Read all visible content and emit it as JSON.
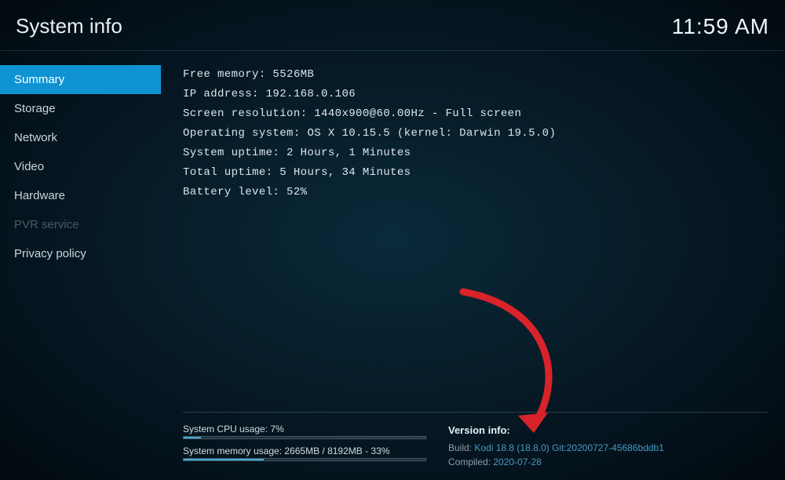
{
  "header": {
    "title": "System info",
    "clock": "11:59 AM"
  },
  "sidebar": {
    "items": [
      {
        "label": "Summary",
        "state": "selected"
      },
      {
        "label": "Storage",
        "state": ""
      },
      {
        "label": "Network",
        "state": ""
      },
      {
        "label": "Video",
        "state": ""
      },
      {
        "label": "Hardware",
        "state": ""
      },
      {
        "label": "PVR service",
        "state": "disabled"
      },
      {
        "label": "Privacy policy",
        "state": ""
      }
    ]
  },
  "summary": {
    "rows": [
      {
        "label": "Free memory: ",
        "value": "5526MB"
      },
      {
        "label": "IP address: ",
        "value": "192.168.0.106"
      },
      {
        "label": "Screen resolution: ",
        "value": "1440x900@60.00Hz - Full screen"
      },
      {
        "label": "Operating system: ",
        "value": "OS X 10.15.5 (kernel: Darwin 19.5.0)"
      },
      {
        "label": "System uptime: ",
        "value": "2 Hours, 1 Minutes"
      },
      {
        "label": "Total uptime: ",
        "value": "5 Hours, 34 Minutes"
      },
      {
        "label": "Battery level: ",
        "value": "52%"
      }
    ]
  },
  "footer": {
    "cpu": {
      "label": "System CPU usage: 7%",
      "pct": 7
    },
    "memory": {
      "label": "System memory usage: 2665MB / 8192MB - 33%",
      "pct": 33
    },
    "version": {
      "title": "Version info:",
      "build_key": "Build: ",
      "build_val": "Kodi 18.8 (18.8.0) Git:20200727-45686bddb1",
      "compiled_key": "Compiled: ",
      "compiled_val": "2020-07-28"
    }
  }
}
